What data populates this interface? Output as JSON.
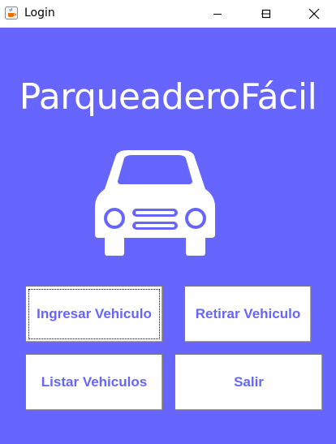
{
  "window": {
    "title": "Login",
    "app_icon": "java-coffee-cup-icon",
    "controls": [
      "minimize-icon",
      "maximize-icon",
      "close-icon"
    ]
  },
  "main": {
    "brand_title": "ParqueaderoFácil",
    "logo": "car-icon",
    "background_color": "#6666ff",
    "accent_text_color": "#6666ff"
  },
  "buttons": {
    "ingresar": "Ingresar Vehiculo",
    "retirar": "Retirar Vehiculo",
    "listar": "Listar Vehiculos",
    "salir": "Salir"
  }
}
